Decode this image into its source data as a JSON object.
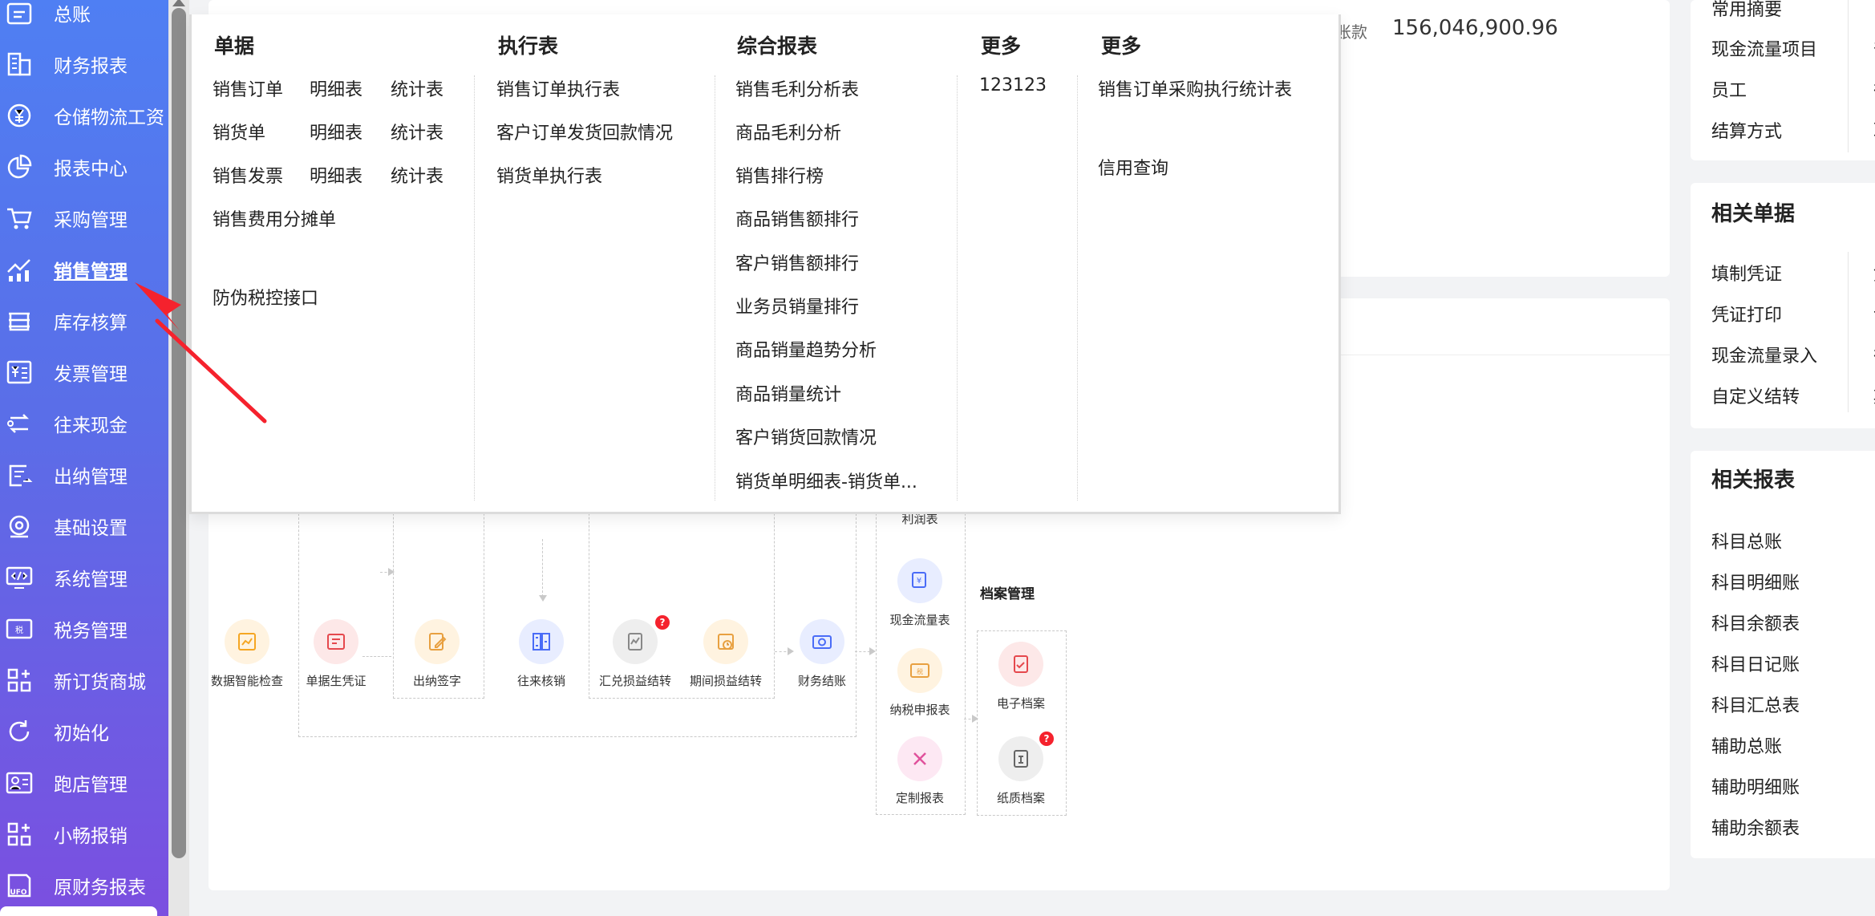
{
  "sidebar": {
    "items": [
      {
        "label": "总账",
        "icon": "ledger-icon"
      },
      {
        "label": "财务报表",
        "icon": "building-icon"
      },
      {
        "label": "仓储物流工资",
        "icon": "yen-cycle-icon"
      },
      {
        "label": "报表中心",
        "icon": "pie-chart-icon"
      },
      {
        "label": "采购管理",
        "icon": "cart-icon"
      },
      {
        "label": "销售管理",
        "icon": "trend-chart-icon"
      },
      {
        "label": "库存核算",
        "icon": "inventory-icon"
      },
      {
        "label": "发票管理",
        "icon": "invoice-icon"
      },
      {
        "label": "往来现金",
        "icon": "transfer-icon"
      },
      {
        "label": "出纳管理",
        "icon": "cashier-icon"
      },
      {
        "label": "基础设置",
        "icon": "settings-icon"
      },
      {
        "label": "系统管理",
        "icon": "code-monitor-icon"
      },
      {
        "label": "税务管理",
        "icon": "tax-icon"
      },
      {
        "label": "新订货商城",
        "icon": "apps-icon"
      },
      {
        "label": "初始化",
        "icon": "refresh-icon"
      },
      {
        "label": "跑店管理",
        "icon": "profile-card-icon"
      },
      {
        "label": "小畅报销",
        "icon": "grid-plus-icon"
      },
      {
        "label": "原财务报表",
        "icon": "ufo-icon"
      }
    ],
    "active": "销售管理"
  },
  "top_amounts": {
    "label": "财账款",
    "value": "156,046,900.96"
  },
  "dropdown": {
    "columns": [
      {
        "title": "单据",
        "key": "documents"
      },
      {
        "title": "执行表",
        "key": "execution"
      },
      {
        "title": "综合报表",
        "key": "reports"
      },
      {
        "title": "更多",
        "key": "more1"
      },
      {
        "title": "更多",
        "key": "more2"
      }
    ],
    "documents": {
      "rows": [
        [
          "销售订单",
          "明细表",
          "统计表"
        ],
        [
          "销货单",
          "明细表",
          "统计表"
        ],
        [
          "销售发票",
          "明细表",
          "统计表"
        ]
      ],
      "extra1": "销售费用分摊单",
      "extra2": "防伪税控接口"
    },
    "execution": [
      "销售订单执行表",
      "客户订单发货回款情况",
      "销货单执行表"
    ],
    "reports": [
      "销售毛利分析表",
      "商品毛利分析",
      "销售排行榜",
      "商品销售额排行",
      "客户销售额排行",
      "业务员销量排行",
      "商品销量趋势分析",
      "商品销量统计",
      "客户销货回款情况",
      "销货单明细表-销货单..."
    ],
    "more1": [
      "123123"
    ],
    "more2": [
      "销售订单采购执行统计表",
      "信用查询"
    ]
  },
  "right_panels": {
    "top_items": [
      "常用摘要",
      "现金流量项目",
      "员工",
      "结算方式"
    ],
    "top_edge": [
      "部",
      "往",
      "职"
    ],
    "docs_title": "相关单据",
    "docs_items": [
      "填制凭证",
      "凭证打印",
      "现金流量录入",
      "自定义结转"
    ],
    "docs_edge": [
      "凭",
      "记",
      "往",
      "期"
    ],
    "reports_title": "相关报表",
    "reports_items": [
      "科目总账",
      "科目明细账",
      "科目余额表",
      "科目日记账",
      "科目汇总表",
      "辅助总账",
      "辅助明细账",
      "辅助余额表"
    ]
  },
  "flow": {
    "items": [
      {
        "label": "数据智能检查",
        "color": "#f5a623",
        "bg": "#fff3e0"
      },
      {
        "label": "单据生凭证",
        "color": "#e5484d",
        "bg": "#fde8e8"
      },
      {
        "label": "出纳签字",
        "color": "#e8a040",
        "bg": "#fff3e0"
      },
      {
        "label": "往来核销",
        "color": "#4a6cf7",
        "bg": "#e8edff"
      },
      {
        "label": "汇兑损益结转",
        "color": "#888888",
        "bg": "#eeeeee"
      },
      {
        "label": "期间损益结转",
        "color": "#e8a040",
        "bg": "#fff3e0"
      },
      {
        "label": "财务结账",
        "color": "#4a6cf7",
        "bg": "#e8edff"
      }
    ],
    "report_col": [
      {
        "label": "利润表"
      },
      {
        "label": "现金流量表",
        "color": "#4a6cf7",
        "bg": "#e8edff"
      },
      {
        "label": "纳税申报表",
        "color": "#e8a040",
        "bg": "#fff3e0"
      },
      {
        "label": "定制报表",
        "color": "#e0529c",
        "bg": "#fde8f3"
      }
    ],
    "archive_title": "档案管理",
    "archive": [
      {
        "label": "电子档案",
        "color": "#e5484d",
        "bg": "#fde8e8"
      },
      {
        "label": "纸质档案",
        "color": "#666666",
        "bg": "#eeeeee"
      }
    ],
    "badge": "?"
  },
  "colors": {
    "accent": "#4f7ff3",
    "sidebar_end": "#7b4fe0",
    "annotation": "#f5222d"
  }
}
